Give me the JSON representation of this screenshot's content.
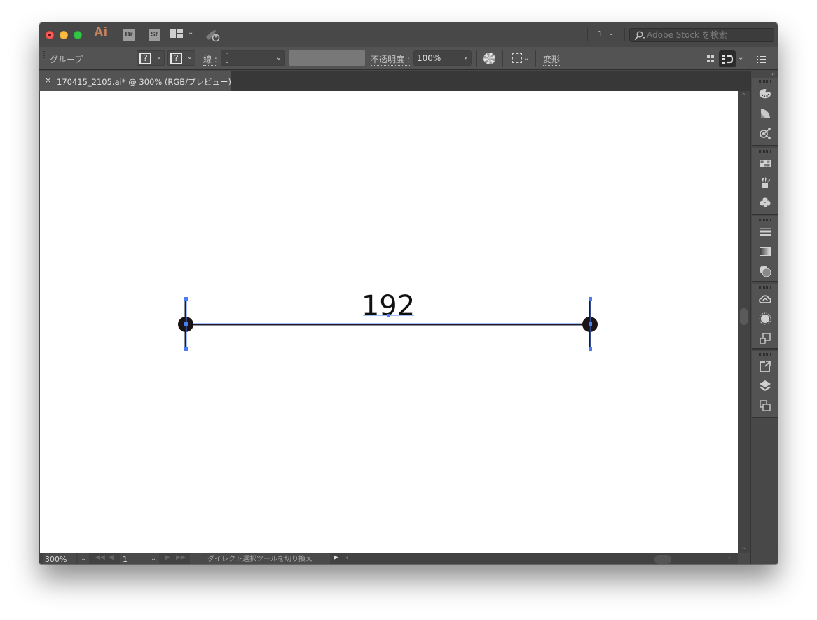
{
  "app": {
    "logo": "Ai",
    "bridge_label": "Br",
    "stock_label": "St"
  },
  "titlebar": {
    "page_value": "1",
    "stock_search_placeholder": "Adobe Stock を検索"
  },
  "controlbar": {
    "selection_type": "グループ",
    "fill_value": "?",
    "stroke_color_value": "?",
    "stroke_label": "線 :",
    "stroke_weight_value": "",
    "opacity_label": "不透明度 :",
    "opacity_value": "100%",
    "transform_label": "変形"
  },
  "document": {
    "tab_close": "×",
    "tab_title": "170415_2105.ai* @ 300% (RGB/プレビュー)"
  },
  "artwork": {
    "dimension_text": "192",
    "line_color": "#3a3a5a",
    "endpoint_color": "#1c1414",
    "selection_color": "#4a7ef5"
  },
  "statusbar": {
    "zoom_value": "300%",
    "artboard_value": "1",
    "status_text": "ダイレクト選択ツールを切り換え"
  },
  "dock": {
    "groups": [
      {
        "icons": [
          "color-palette-icon",
          "color-guide-icon",
          "symbols-sprayer-icon"
        ]
      },
      {
        "icons": [
          "swatches-icon",
          "brushes-icon",
          "symbols-club-icon"
        ]
      },
      {
        "icons": [
          "stroke-icon",
          "gradient-icon",
          "transparency-icon"
        ]
      },
      {
        "icons": [
          "creative-cloud-libraries-icon",
          "appearance-icon",
          "graphic-styles-icon"
        ]
      },
      {
        "icons": [
          "export-icon",
          "layers-icon",
          "artboards-icon"
        ]
      }
    ]
  }
}
